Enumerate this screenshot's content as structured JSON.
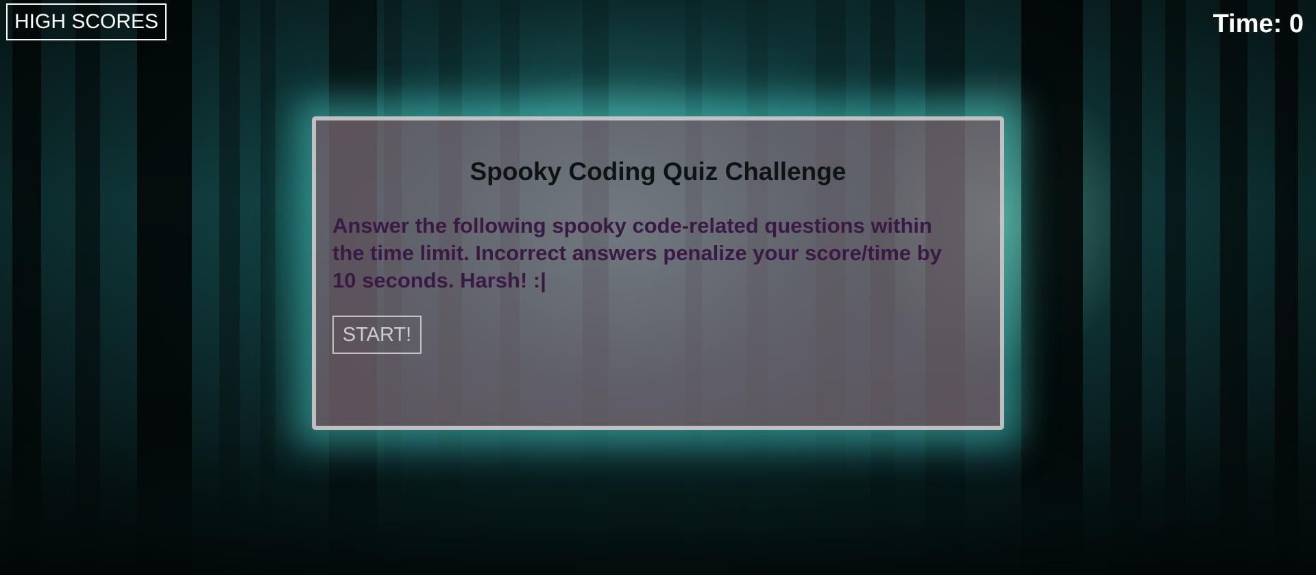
{
  "header": {
    "high_scores_label": "HIGH SCORES",
    "timer_text": "Time: 0"
  },
  "quiz_card": {
    "title": "Spooky Coding Quiz Challenge",
    "instructions": "Answer the following spooky code-related questions within the time limit. Incorrect answers penalize your score/time by 10 seconds. Harsh! :|",
    "start_label": "START!"
  },
  "colors": {
    "card_glow": "#46c8c3",
    "instruction_text": "#3a1a44",
    "title_text": "#0d1414"
  }
}
